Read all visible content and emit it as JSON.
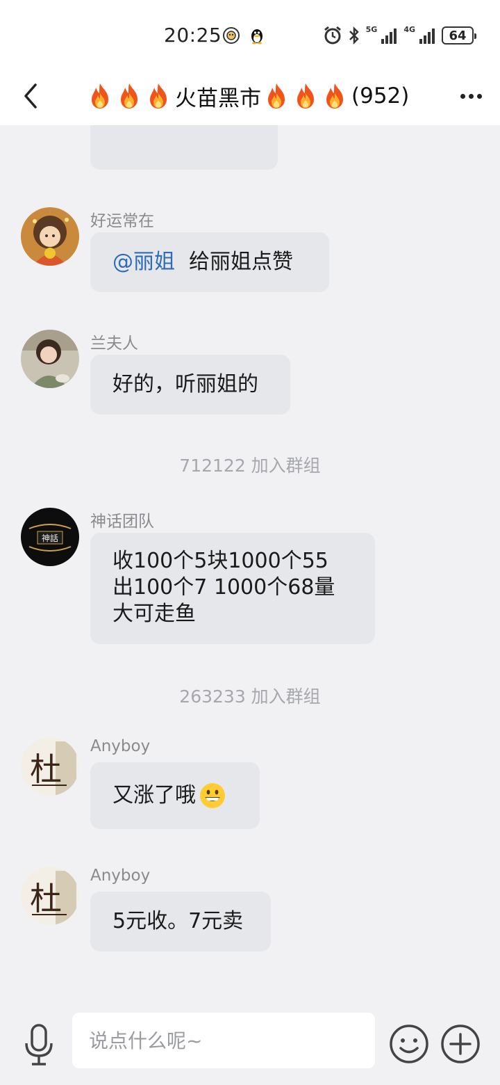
{
  "status_bar": {
    "time": "20:25",
    "signal1_label": "5G",
    "signal2_label": "4G",
    "battery": "64",
    "icons": [
      "app-badge-icon",
      "qq-penguin-icon",
      "alarm-icon",
      "bluetooth-icon",
      "signal-5g-icon",
      "signal-4g-icon",
      "battery-icon"
    ]
  },
  "header": {
    "title": "火苗黑市",
    "member_count": "(952)",
    "back_icon": "back-arrow-icon",
    "more_icon": "more-dots-icon",
    "title_icon": "fire-emoji"
  },
  "messages": [
    {
      "sender": "好运常在",
      "mention": "@丽姐",
      "text": "给丽姐点赞"
    },
    {
      "sender": "兰夫人",
      "text": "好的，听丽姐的"
    },
    {
      "system": "712122 加入群组"
    },
    {
      "sender": "神话团队",
      "avatar_text": "神話",
      "lines": [
        "收100个5块1000个55",
        "出100个7 1000个68量",
        "大可走鱼"
      ]
    },
    {
      "system": "263233 加入群组"
    },
    {
      "sender": "Anyboy",
      "avatar_text": "杜",
      "text": "又涨了哦",
      "emoji": "grinning-face-emoji"
    },
    {
      "sender": "Anyboy",
      "avatar_text": "杜",
      "text": "5元收。7元卖"
    }
  ],
  "input": {
    "placeholder": "说点什么呢~"
  },
  "bottom_icons": [
    "microphone-icon",
    "emoji-smile-icon",
    "plus-circle-icon"
  ],
  "colors": {
    "background": "#f1f1f3",
    "bubble": "#e6e7eb",
    "mention": "#2f6bb8",
    "sender": "#8a8a8e",
    "system_text": "#a7a8ad"
  }
}
